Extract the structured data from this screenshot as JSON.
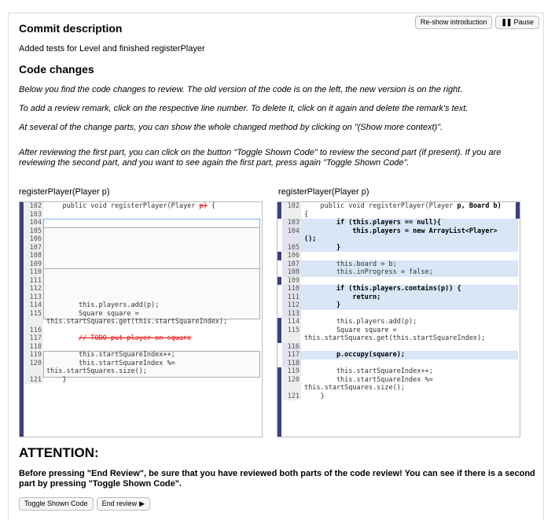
{
  "header": {
    "commit_heading": "Commit description",
    "commit_text": "Added tests for Level and finished registerPlayer",
    "reshow_label": "Re-show introduction",
    "pause_label": "Pause"
  },
  "code_changes": {
    "heading": "Code changes",
    "p1": "Below you find the code changes to review. The old version of the code is on the left, the new version is on the right.",
    "p2": "To add a review remark, click on the respective line number. To delete it, click on it again and delete the remark's text.",
    "p3": "At several of the change parts, you can show the whole changed method by clicking on \"(Show more context)\".",
    "p4": "After reviewing the first part, you can click on the button \"Toggle Shown Code\" to review the second part (if present). If you are reviewing the second part, and you want to see again the first part, press again \"Toggle Shown Code\"."
  },
  "left_pane": {
    "title": "registerPlayer(Player p)",
    "lines": [
      {
        "n": "102",
        "code": "    public void registerPlayer(Player ",
        "del": "p)",
        "rest": " {"
      },
      {
        "n": "103",
        "code": ""
      },
      {
        "n": "104",
        "code": ""
      },
      {
        "n": "105",
        "code": ""
      },
      {
        "n": "106",
        "code": ""
      },
      {
        "n": "107",
        "code": ""
      },
      {
        "n": "108",
        "code": ""
      },
      {
        "n": "109",
        "code": ""
      },
      {
        "n": "110",
        "code": ""
      },
      {
        "n": "111",
        "code": ""
      },
      {
        "n": "112",
        "code": ""
      },
      {
        "n": "113",
        "code": ""
      },
      {
        "n": "114",
        "code": "        this.players.add(p);"
      },
      {
        "n": "115",
        "code": "        Square square ="
      },
      {
        "n": "",
        "code": "this.startSquares.get(this.startSquareIndex);"
      },
      {
        "n": "116",
        "code": ""
      },
      {
        "n": "117",
        "code": "        ",
        "del": "// TODO put player on square"
      },
      {
        "n": "118",
        "code": ""
      },
      {
        "n": "119",
        "code": "        this.startSquareIndex++;"
      },
      {
        "n": "120",
        "code": "        this.startSquareIndex %="
      },
      {
        "n": "",
        "code": "this.startSquares.size();"
      },
      {
        "n": "121",
        "code": "    }"
      }
    ]
  },
  "right_pane": {
    "title": "registerPlayer(Player p)",
    "lines": [
      {
        "n": "102",
        "code": "    public void registerPlayer(Player ",
        "hl": "p, Board b)"
      },
      {
        "n": "",
        "code": "{"
      },
      {
        "n": "103",
        "hl": "        if (this.players == null){",
        "blue": true
      },
      {
        "n": "104",
        "hl": "            this.players = new ArrayList<Player>",
        "blue": true
      },
      {
        "n": "",
        "hl": "();",
        "blue": true
      },
      {
        "n": "105",
        "hl": "        }",
        "blue": true
      },
      {
        "n": "106",
        "code": ""
      },
      {
        "n": "107",
        "code": "        this.board = b;",
        "blue": true
      },
      {
        "n": "108",
        "code": "        this.inProgress = false;",
        "blue": true
      },
      {
        "n": "109",
        "code": ""
      },
      {
        "n": "110",
        "hl": "        if (this.players.contains(p)) {",
        "blue": true
      },
      {
        "n": "111",
        "hl": "            return;",
        "blue": true
      },
      {
        "n": "112",
        "hl": "        }",
        "blue": true
      },
      {
        "n": "113",
        "code": "",
        "blue": true
      },
      {
        "n": "114",
        "code": "        this.players.add(p);"
      },
      {
        "n": "115",
        "code": "        Square square ="
      },
      {
        "n": "",
        "code": "this.startSquares.get(this.startSquareIndex);"
      },
      {
        "n": "116",
        "code": "",
        "blue": true
      },
      {
        "n": "117",
        "hl": "        p.occupy(square);",
        "blue": true
      },
      {
        "n": "118",
        "code": "",
        "blue": true
      },
      {
        "n": "119",
        "code": "        this.startSquareIndex++;"
      },
      {
        "n": "120",
        "code": "        this.startSquareIndex %="
      },
      {
        "n": "",
        "code": "this.startSquares.size();"
      },
      {
        "n": "121",
        "code": "    }"
      }
    ]
  },
  "attention": {
    "heading": "ATTENTION:",
    "text": "Before pressing \"End Review\", be sure that you have reviewed both parts of the code review! You can see if there is a second part by pressing \"Toggle Shown Code\"."
  },
  "footer": {
    "toggle_label": "Toggle Shown Code",
    "end_label": "End review"
  }
}
